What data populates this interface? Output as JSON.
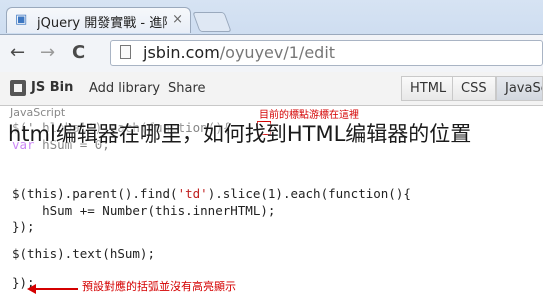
{
  "browser": {
    "tab_title": "jQuery 開發實戰 - 進階繞",
    "tab_close": "×",
    "favicon_glyph": "▣",
    "nav": {
      "back": "←",
      "forward": "→",
      "reload": "C"
    },
    "url_main": "jsbin.com",
    "url_path": "/oyuyev/1/edit"
  },
  "jsbin": {
    "brand": "JS Bin",
    "menu": [
      "Add library",
      "Share"
    ],
    "panels": [
      "HTML",
      "CSS",
      "JavaSc"
    ],
    "active_panel": "JavaSc",
    "pane_label": "JavaScript"
  },
  "code": {
    "line1": "$('.hlobal').each(function(){",
    "line2_kw": "var",
    "line2_rest": " hSum = 0;",
    "line3_a": "$(this).parent().find(",
    "line3_str": "'td'",
    "line3_b": ").slice(1).each(function(){",
    "line4": "    hSum += Number(this.innerHTML);",
    "line5": "});",
    "line6": "$(this).text(hSum);",
    "line7": "});"
  },
  "annotations": {
    "top": "目前的標點游標在這裡",
    "bottom": "預設對應的括弧並沒有高亮顯示"
  },
  "caption": "html编辑器在哪里，如何找到HTML编辑器的位置",
  "colors": {
    "annotation": "#d40000",
    "chrome": "#c6d7ee"
  }
}
